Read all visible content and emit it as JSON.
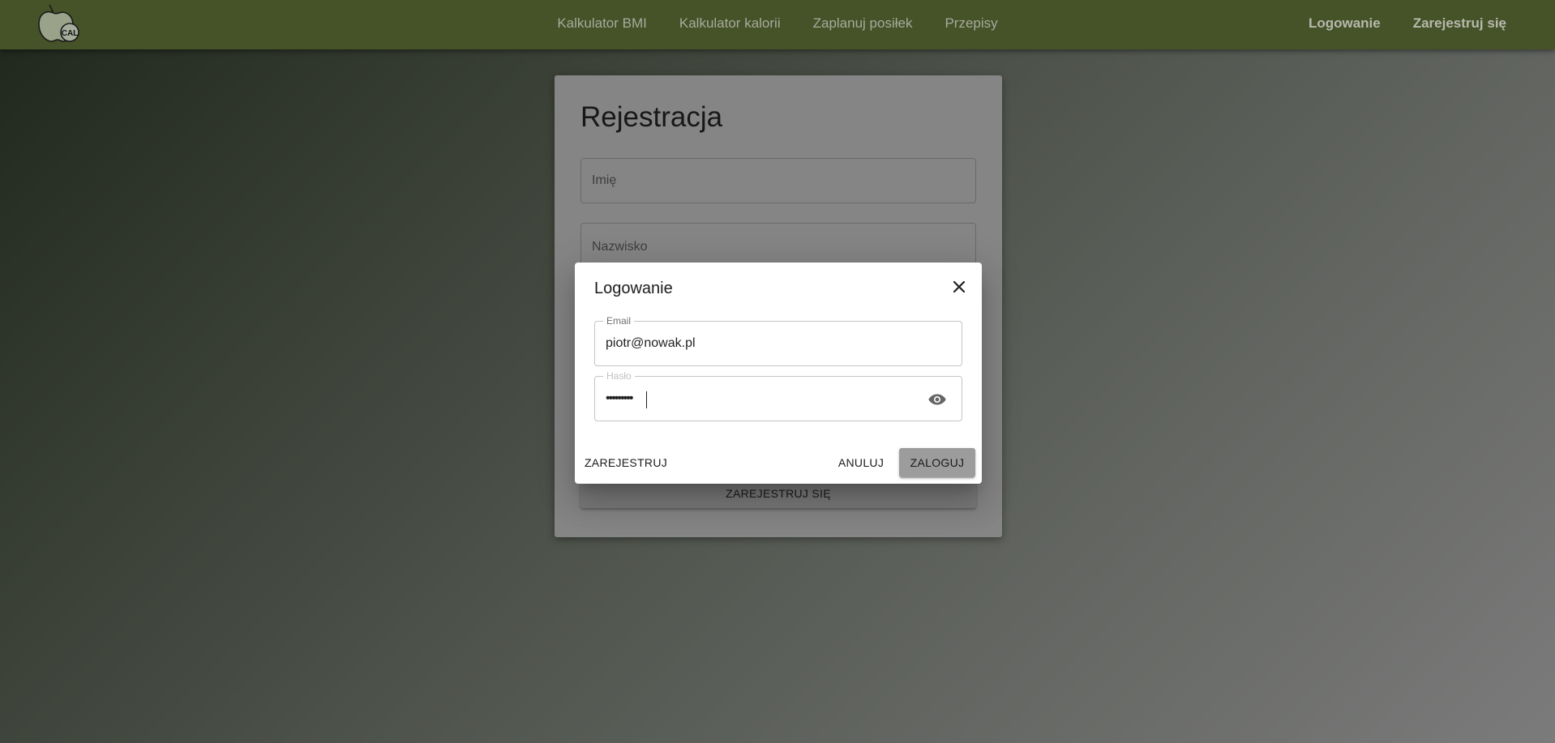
{
  "nav": {
    "logo_text": "CAL",
    "center_links": [
      "Kalkulator BMI",
      "Kalkulator kalorii",
      "Zaplanuj posiłek",
      "Przepisy"
    ],
    "login_label": "Logowanie",
    "register_label": "Zarejestruj się"
  },
  "registration": {
    "title": "Rejestracja",
    "first_name_placeholder": "Imię",
    "last_name_placeholder": "Nazwisko",
    "submit_label": "ZAREJESTRUJ SIĘ"
  },
  "login_dialog": {
    "title": "Logowanie",
    "email_label": "Email",
    "email_value": "piotr@nowak.pl",
    "password_label": "Hasło",
    "password_value": "•••••••••",
    "register_button": "ZAREJESTRUJ",
    "cancel_button": "ANULUJ",
    "login_button": "ZALOGUJ"
  },
  "colors": {
    "navbar": "#465228",
    "dialog_primary_button": "#9c9c9c"
  },
  "icons": {
    "logo": "apple-logo-icon",
    "close": "close-icon",
    "password_visibility": "eye-icon"
  }
}
